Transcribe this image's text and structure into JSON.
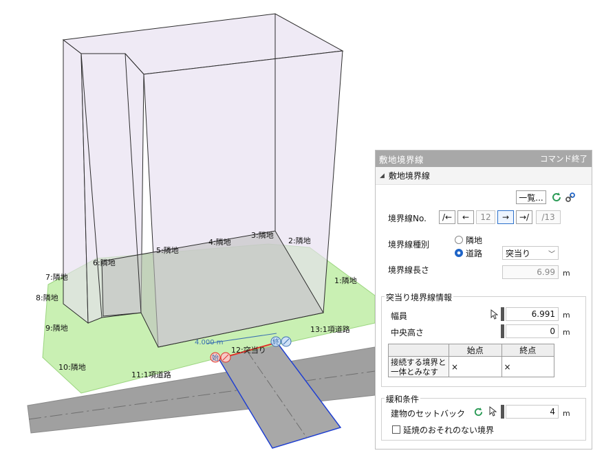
{
  "scene": {
    "boundary_labels": [
      "1:隣地",
      "2:隣地",
      "3:隣地",
      "4:隣地",
      "5:隣地",
      "6:隣地",
      "7:隣地",
      "8:隣地",
      "9:隣地",
      "10:隣地",
      "11:1項道路",
      "12:突当り",
      "13:1項道路"
    ],
    "dimension_label": "4.000 m",
    "start_marker": "始",
    "end_marker": "終"
  },
  "panel": {
    "title": "敷地境界線",
    "end_command": "コマンド終了",
    "section": "敷地境界線",
    "list_button": "一覧...",
    "boundary_no_label": "境界線No.",
    "nav_buttons": [
      "/←",
      "←",
      "→",
      "→/"
    ],
    "current_no": "12",
    "total_no": "/13",
    "type_label": "境界線種別",
    "radio_neighbor": "隣地",
    "radio_road": "道路",
    "road_type_select": "突当り",
    "length_label": "境界線長さ",
    "length_value": "6.99",
    "length_unit": "m",
    "deadend_group": "突当り境界線情報",
    "width_label": "幅員",
    "width_value": "6.991",
    "width_unit": "m",
    "center_height_label": "中央高さ",
    "center_height_value": "0",
    "center_height_unit": "m",
    "table": {
      "headers": [
        "",
        "始点",
        "終点"
      ],
      "row_label": "接続する境界と一体とみなす",
      "start_value": "×",
      "end_value": "×"
    },
    "relax_group": "緩和条件",
    "setback_label": "建物のセットバック",
    "setback_value": "4",
    "setback_unit": "m",
    "fireproof_label": "延焼のおそれのない境界"
  },
  "colors": {
    "site_green": "#c9f0b3",
    "volume_lavender": "#e6deef",
    "road_gray": "#9e9e9e",
    "accent_blue": "#1f64c7",
    "boundary_red": "#e0322a"
  }
}
